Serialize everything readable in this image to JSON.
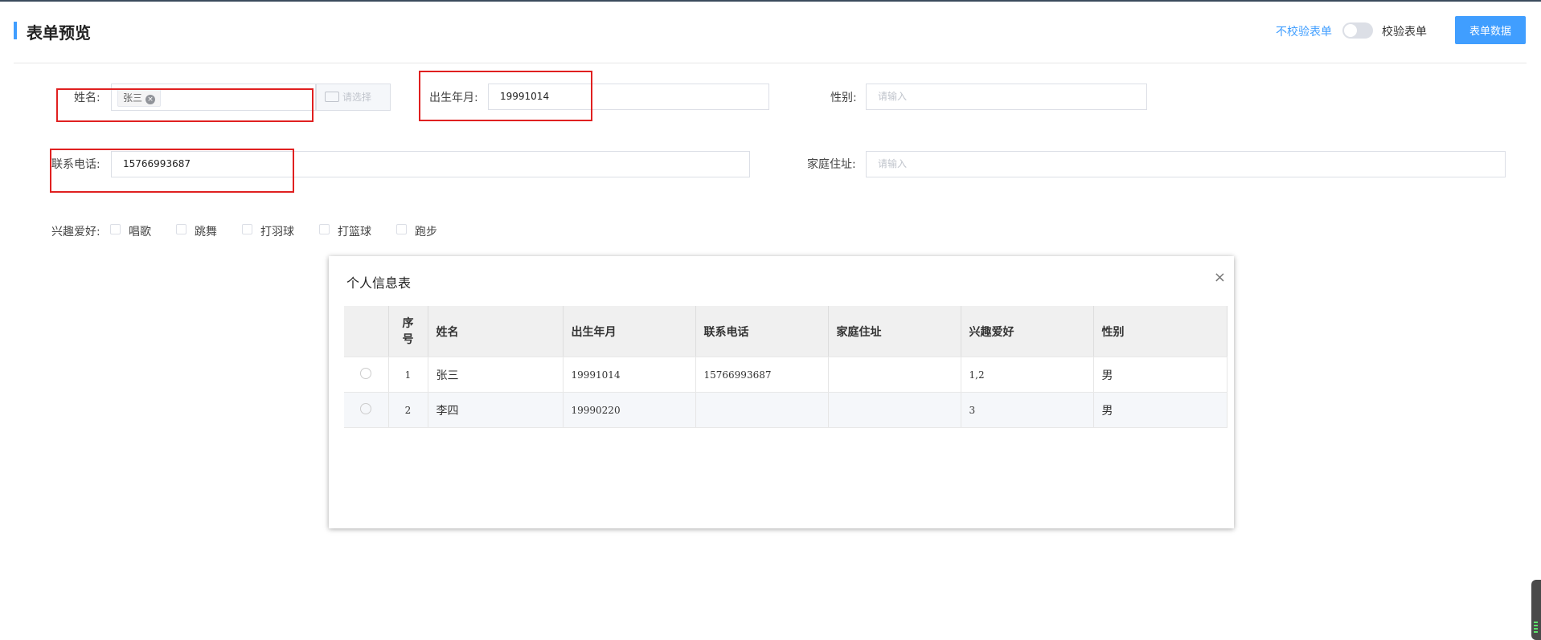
{
  "header": {
    "title": "表单预览",
    "toggle_off_label": "不校验表单",
    "toggle_on_label": "校验表单",
    "form_data_button": "表单数据"
  },
  "form": {
    "name": {
      "label": "姓名:",
      "tag": "张三",
      "select_button": "请选择"
    },
    "birth": {
      "label": "出生年月:",
      "value": "19991014"
    },
    "gender": {
      "label": "性别:",
      "placeholder": "请输入"
    },
    "phone": {
      "label": "联系电话:",
      "value": "15766993687"
    },
    "address": {
      "label": "家庭住址:",
      "placeholder": "请输入"
    },
    "hobbies": {
      "label": "兴趣爱好:",
      "options": [
        "唱歌",
        "跳舞",
        "打羽球",
        "打篮球",
        "跑步"
      ]
    }
  },
  "dialog": {
    "title": "个人信息表",
    "close": "×",
    "columns": [
      "序号",
      "姓名",
      "出生年月",
      "联系电话",
      "家庭住址",
      "兴趣爱好",
      "性别"
    ],
    "rows": [
      {
        "no": "1",
        "name": "张三",
        "birth": "19991014",
        "phone": "15766993687",
        "address": "",
        "hobbies": "1,2",
        "gender": "男"
      },
      {
        "no": "2",
        "name": "李四",
        "birth": "19990220",
        "phone": "",
        "address": "",
        "hobbies": "3",
        "gender": "男"
      }
    ]
  },
  "colors": {
    "accent": "#409eff",
    "highlight_box": "#e02020"
  }
}
